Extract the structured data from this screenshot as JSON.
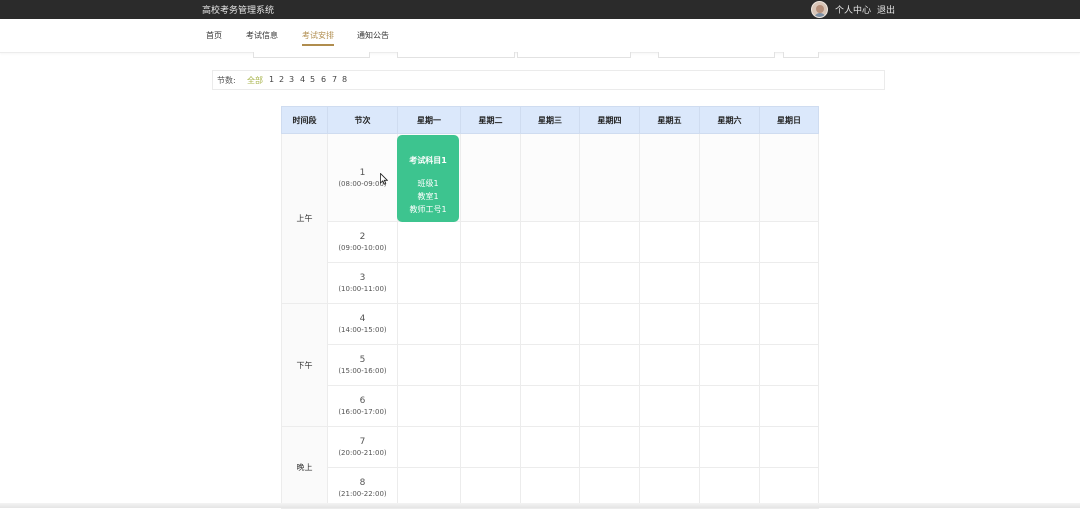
{
  "header": {
    "site_title": "高校考务管理系统",
    "user_center": "个人中心",
    "logout": "退出"
  },
  "nav": {
    "items": [
      {
        "label": "首页"
      },
      {
        "label": "考试信息"
      },
      {
        "label": "考试安排",
        "active": true
      },
      {
        "label": "通知公告"
      }
    ]
  },
  "filter": {
    "label": "节数:",
    "options": [
      "全部",
      "1",
      "2",
      "3",
      "4",
      "5",
      "6",
      "7",
      "8"
    ],
    "selected": "全部"
  },
  "schedule": {
    "headers": [
      "时间段",
      "节次",
      "星期一",
      "星期二",
      "星期三",
      "星期四",
      "星期五",
      "星期六",
      "星期日"
    ],
    "periods": [
      "上午",
      "下午",
      "晚上"
    ],
    "slots": [
      {
        "num": "1",
        "time": "(08:00-09:00)"
      },
      {
        "num": "2",
        "time": "(09:00-10:00)"
      },
      {
        "num": "3",
        "time": "(10:00-11:00)"
      },
      {
        "num": "4",
        "time": "(14:00-15:00)"
      },
      {
        "num": "5",
        "time": "(15:00-16:00)"
      },
      {
        "num": "6",
        "time": "(16:00-17:00)"
      },
      {
        "num": "7",
        "time": "(20:00-21:00)"
      },
      {
        "num": "8",
        "time": "(21:00-22:00)"
      }
    ],
    "event": {
      "subject": "考试科目1",
      "class": "班级1",
      "room": "教室1",
      "teacher": "教师工号1",
      "day": "星期一",
      "slot": "1",
      "color": "#3dc48f"
    }
  },
  "colors": {
    "accent": "#b08d4e",
    "filter_active": "#a7b34a",
    "header_bg": "#dbe8fb",
    "topbar_bg": "#2b2b2b"
  }
}
